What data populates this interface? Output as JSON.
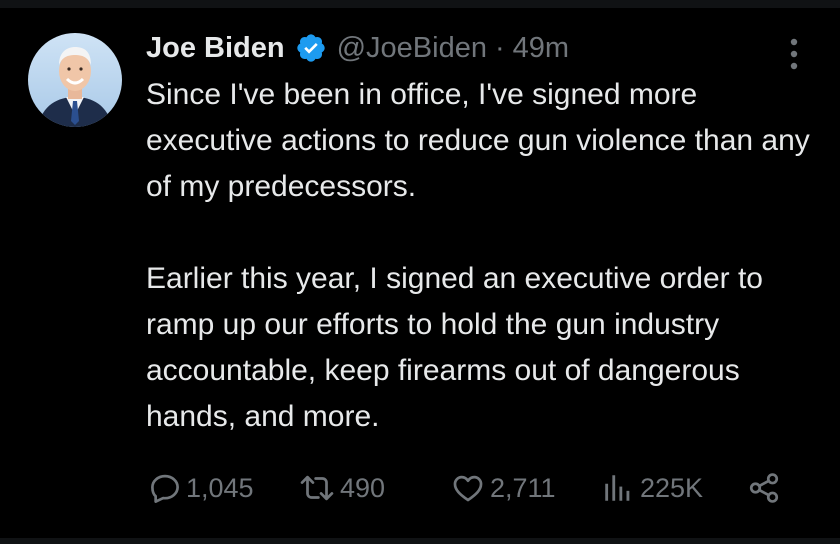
{
  "tweet": {
    "author_name": "Joe Biden",
    "handle": "@JoeBiden",
    "separator": "·",
    "time": "49m",
    "paragraph_1": "Since I've been in office, I've signed more executive actions to reduce gun violence than any of my predecessors.",
    "paragraph_2": "Earlier this year, I signed an executive order to ramp up our efforts to hold the gun industry accountable, keep firearms out of dangerous hands, and more."
  },
  "actions": {
    "replies": "1,045",
    "reposts": "490",
    "likes": "2,711",
    "views": "225K"
  },
  "icons": {
    "verified": "verified-badge-icon",
    "more": "more-options-icon",
    "reply": "reply-icon",
    "repost": "repost-icon",
    "like": "heart-icon",
    "views": "views-icon",
    "share": "share-icon"
  },
  "colors": {
    "background": "#000000",
    "text_primary": "#e7e9ea",
    "text_secondary": "#71767b",
    "verified_badge": "#1d9bf0"
  }
}
